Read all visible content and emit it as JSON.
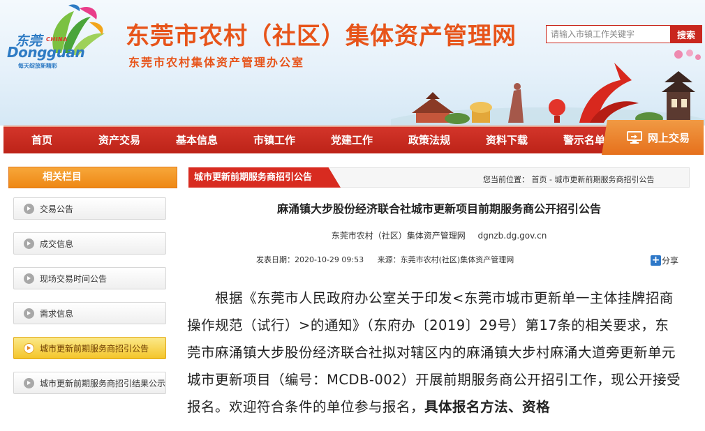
{
  "header": {
    "logo": {
      "cn": "东莞",
      "china": "CHINA",
      "en": "Dongguan",
      "slogan": "每天绽放新精彩"
    },
    "title": "东莞市农村（社区）集体资产管理网",
    "subtitle": "东莞市农村集体资产管理办公室",
    "search": {
      "placeholder": "请输入市镇工作关键字",
      "button": "搜索"
    }
  },
  "nav": {
    "items": [
      "首页",
      "资产交易",
      "基本信息",
      "市镇工作",
      "党建工作",
      "政策法规",
      "资料下载",
      "警示名单"
    ],
    "online": "网上交易"
  },
  "sidebar": {
    "title": "相关栏目",
    "items": [
      {
        "label": "交易公告",
        "active": false
      },
      {
        "label": "成交信息",
        "active": false
      },
      {
        "label": "现场交易时间公告",
        "active": false
      },
      {
        "label": "需求信息",
        "active": false
      },
      {
        "label": "城市更新前期服务商招引公告",
        "active": true
      },
      {
        "label": "城市更新前期服务商招引结果公示",
        "active": false
      }
    ]
  },
  "main": {
    "tab": "城市更新前期服务商招引公告",
    "breadcrumb": "您当前位置：  首页 - 城市更新前期服务商招引公告",
    "article": {
      "title": "麻涌镇大步股份经济联合社城市更新项目前期服务商公开招引公告",
      "publisher": "东莞市农村（社区）集体资产管理网",
      "site": "dgnzb.dg.gov.cn",
      "date": "发表日期：2020-10-29 09:53",
      "source": "来源：东莞市农村(社区)集体资产管理网",
      "share": "分享",
      "body_plain": "根据《东莞市人民政府办公室关于印发<东莞市城市更新单一主体挂牌招商操作规范（试行）>的通知》（东府办〔2019〕29号）第17条的相关要求，东莞市麻涌镇大步股份经济联合社拟对辖区内的麻涌镇大步村麻涌大道旁更新单元城市更新项目（编号：MCDB-002）开展前期服务商公开招引工作，现公开接受报名。欢迎符合条件的单位参与报名，",
      "body_bold": "具体报名方法、资格"
    }
  },
  "colors": {
    "accent": "#e7541a",
    "nav_red": "#c9271e",
    "sidebar_orange": "#ee8714"
  }
}
